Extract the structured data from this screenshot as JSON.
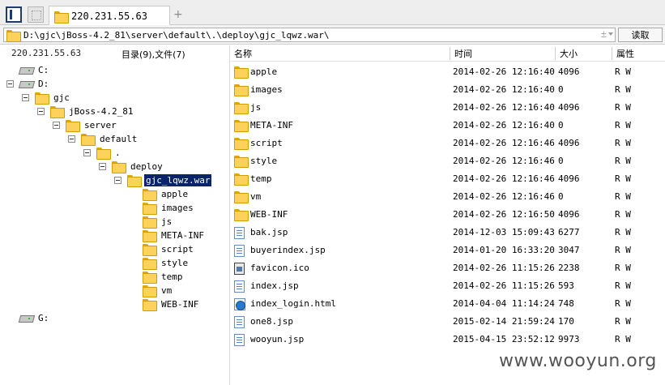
{
  "tab": {
    "title": "220.231.55.63"
  },
  "address": {
    "path": "D:\\gjc\\jBoss-4.2_81\\server\\default\\.\\deploy\\gjc_lqwz.war\\",
    "plusminus": "±",
    "read_button": "读取"
  },
  "left": {
    "ip": "220.231.55.63",
    "count": "目录(9),文件(7)"
  },
  "tree": {
    "c": "C:",
    "d": "D:",
    "gjc": "gjc",
    "jboss": "jBoss-4.2_81",
    "server": "server",
    "default": "default",
    "dot": ".",
    "deploy": "deploy",
    "war": "gjc_lqwz.war",
    "children": [
      "apple",
      "images",
      "js",
      "META-INF",
      "script",
      "style",
      "temp",
      "vm",
      "WEB-INF"
    ],
    "g": "G:"
  },
  "columns": {
    "name": "名称",
    "time": "时间",
    "size": "大小",
    "attr": "属性"
  },
  "files": [
    {
      "name": "apple",
      "time": "2014-02-26 12:16:40",
      "size": "4096",
      "attr": "R W",
      "type": "folder"
    },
    {
      "name": "images",
      "time": "2014-02-26 12:16:40",
      "size": "0",
      "attr": "R W",
      "type": "folder"
    },
    {
      "name": "js",
      "time": "2014-02-26 12:16:40",
      "size": "4096",
      "attr": "R W",
      "type": "folder"
    },
    {
      "name": "META-INF",
      "time": "2014-02-26 12:16:40",
      "size": "0",
      "attr": "R W",
      "type": "folder"
    },
    {
      "name": "script",
      "time": "2014-02-26 12:16:46",
      "size": "4096",
      "attr": "R W",
      "type": "folder"
    },
    {
      "name": "style",
      "time": "2014-02-26 12:16:46",
      "size": "0",
      "attr": "R W",
      "type": "folder"
    },
    {
      "name": "temp",
      "time": "2014-02-26 12:16:46",
      "size": "4096",
      "attr": "R W",
      "type": "folder"
    },
    {
      "name": "vm",
      "time": "2014-02-26 12:16:46",
      "size": "0",
      "attr": "R W",
      "type": "folder"
    },
    {
      "name": "WEB-INF",
      "time": "2014-02-26 12:16:50",
      "size": "4096",
      "attr": "R W",
      "type": "folder"
    },
    {
      "name": "bak.jsp",
      "time": "2014-12-03 15:09:43",
      "size": "6277",
      "attr": "R W",
      "type": "file"
    },
    {
      "name": "buyerindex.jsp",
      "time": "2014-01-20 16:33:20",
      "size": "3047",
      "attr": "R W",
      "type": "file"
    },
    {
      "name": "favicon.ico",
      "time": "2014-02-26 11:15:26",
      "size": "2238",
      "attr": "R W",
      "type": "ico"
    },
    {
      "name": "index.jsp",
      "time": "2014-02-26 11:15:26",
      "size": "593",
      "attr": "R W",
      "type": "file"
    },
    {
      "name": "index_login.html",
      "time": "2014-04-04 11:14:24",
      "size": "748",
      "attr": "R W",
      "type": "html"
    },
    {
      "name": "one8.jsp",
      "time": "2015-02-14 21:59:24",
      "size": "170",
      "attr": "R W",
      "type": "file"
    },
    {
      "name": "wooyun.jsp",
      "time": "2015-04-15 23:52:12",
      "size": "9973",
      "attr": "R W",
      "type": "file"
    }
  ],
  "watermark": "www.wooyun.org"
}
